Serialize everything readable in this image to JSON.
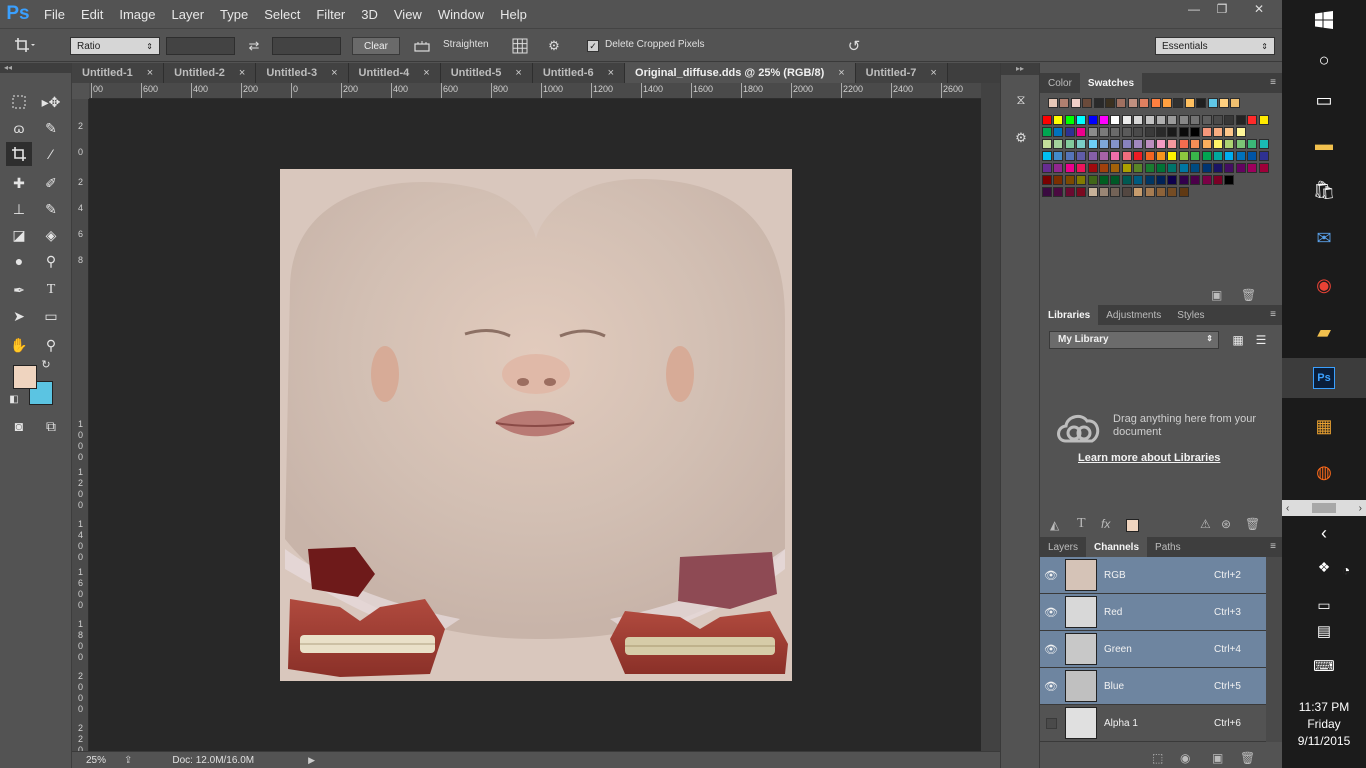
{
  "app": {
    "logo": "Ps"
  },
  "menu": [
    "File",
    "Edit",
    "Image",
    "Layer",
    "Type",
    "Select",
    "Filter",
    "3D",
    "View",
    "Window",
    "Help"
  ],
  "window_controls": {
    "minimize": "—",
    "restore": "❐",
    "close": "✕"
  },
  "options": {
    "ratio_select": "Ratio",
    "clear_label": "Clear",
    "straighten_label": "Straighten",
    "delete_cropped_label": "Delete Cropped Pixels",
    "delete_cropped_checked": true,
    "workspace_select": "Essentials"
  },
  "document_tabs": [
    {
      "label": "Untitled-1",
      "active": false
    },
    {
      "label": "Untitled-2",
      "active": false
    },
    {
      "label": "Untitled-3",
      "active": false
    },
    {
      "label": "Untitled-4",
      "active": false
    },
    {
      "label": "Untitled-5",
      "active": false
    },
    {
      "label": "Untitled-6",
      "active": false
    },
    {
      "label": "Original_diffuse.dds @ 25% (RGB/8)",
      "active": true
    },
    {
      "label": "Untitled-7",
      "active": false
    }
  ],
  "ruler_h": [
    "00",
    "600",
    "400",
    "200",
    "0",
    "200",
    "400",
    "600",
    "800",
    "1000",
    "1200",
    "1400",
    "1600",
    "1800",
    "2000",
    "2200",
    "2400",
    "2600"
  ],
  "ruler_v": [
    "2",
    "0",
    "2",
    "4",
    "6",
    "8",
    "1 0 0 0",
    "1 2 0 0",
    "1 4 0 0",
    "1 6 0 0",
    "1 8 0 0",
    "2 0 0 0",
    "2 2 0 0"
  ],
  "status": {
    "zoom": "25%",
    "doc_info": "Doc: 12.0M/16.0M"
  },
  "swatches_panel": {
    "tabs": [
      "Color",
      "Swatches"
    ],
    "active_tab": "Swatches",
    "recent": [
      "#e8c9b8",
      "#b08070",
      "#f0d0c8",
      "#6a4a3a",
      "#2a2a2a",
      "#3a3020",
      "#a07060",
      "#c09080",
      "#e08060",
      "#ff8040",
      "#ffa040",
      "#303030",
      "#ffc060",
      "#202020",
      "#60c8e8",
      "#ffd080",
      "#f0c070"
    ],
    "rows": [
      [
        "#ff0000",
        "#ffff00",
        "#00ff00",
        "#00ffff",
        "#0000ff",
        "#ff00ff",
        "#ffffff",
        "#ebebeb",
        "#d7d7d7",
        "#c3c3c3",
        "#afafaf",
        "#9b9b9b",
        "#878787",
        "#737373",
        "#5f5f5f",
        "#4b4b4b",
        "#373737",
        "#232323",
        "#ff2a2a",
        "#ffea00"
      ],
      [
        "#00a651",
        "#0072bc",
        "#2e3192",
        "#ec008c",
        "#8c8c8c",
        "#7a7a7a",
        "#6a6a6a",
        "#5a5a5a",
        "#4a4a4a",
        "#3a3a3a",
        "#2a2a2a",
        "#1a1a1a",
        "#0a0a0a",
        "#000000",
        "#f7977a",
        "#f9ad81",
        "#fdc68a",
        "#fff79a"
      ],
      [
        "#c4df9b",
        "#a3d39c",
        "#82ca9d",
        "#7bcdc8",
        "#6ecff6",
        "#7ea7d8",
        "#8493ca",
        "#8882be",
        "#a187be",
        "#bc8dbf",
        "#f49ac2",
        "#f6989d",
        "#f26c4f",
        "#f68e56",
        "#fbaf5d",
        "#fff568",
        "#acd372",
        "#7cc576",
        "#3bb878",
        "#1abbb4"
      ],
      [
        "#00bff3",
        "#438ccb",
        "#5574b9",
        "#605ca8",
        "#855fa8",
        "#a763a8",
        "#f06eaa",
        "#f26d7d",
        "#ed1c24",
        "#f26522",
        "#f7941d",
        "#fff200",
        "#8dc73f",
        "#39b54a",
        "#00a651",
        "#00a99d",
        "#00aeef",
        "#0072bc",
        "#0054a6",
        "#2e3192"
      ],
      [
        "#662d91",
        "#92278f",
        "#ec008c",
        "#ed145b",
        "#9e0b0f",
        "#a0410d",
        "#a3620a",
        "#aba000",
        "#598527",
        "#1a7b30",
        "#007236",
        "#00746b",
        "#0076a3",
        "#004b80",
        "#003471",
        "#1b1464",
        "#440e62",
        "#630460",
        "#9e005d",
        "#9e0039"
      ],
      [
        "#790000",
        "#7b2e00",
        "#7d4900",
        "#827b00",
        "#406618",
        "#005e20",
        "#005826",
        "#005952",
        "#005b7f",
        "#003663",
        "#002157",
        "#0d004c",
        "#32004b",
        "#4b0049",
        "#7b0046",
        "#7a0026",
        "#000000"
      ],
      [
        "#3a0a40",
        "#4a0a40",
        "#6a0a30",
        "#7a0a20",
        "#c7b299",
        "#998675",
        "#736357",
        "#534741",
        "#c69c6d",
        "#a67c52",
        "#8c6239",
        "#754c24",
        "#603913"
      ]
    ]
  },
  "libraries_panel": {
    "tabs": [
      "Libraries",
      "Adjustments",
      "Styles"
    ],
    "active_tab": "Libraries",
    "library_select": "My Library",
    "drag_text": "Drag anything here from your document",
    "learn_more_link": "Learn more about Libraries"
  },
  "channels_panel": {
    "tabs": [
      "Layers",
      "Channels",
      "Paths"
    ],
    "active_tab": "Channels",
    "channels": [
      {
        "name": "RGB",
        "shortcut": "Ctrl+2",
        "visible": true,
        "selected": true
      },
      {
        "name": "Red",
        "shortcut": "Ctrl+3",
        "visible": true,
        "selected": true
      },
      {
        "name": "Green",
        "shortcut": "Ctrl+4",
        "visible": true,
        "selected": true
      },
      {
        "name": "Blue",
        "shortcut": "Ctrl+5",
        "visible": true,
        "selected": true
      },
      {
        "name": "Alpha 1",
        "shortcut": "Ctrl+6",
        "visible": false,
        "selected": false
      }
    ]
  },
  "taskbar": {
    "time": "11:37 PM",
    "day": "Friday",
    "date": "9/11/2015",
    "ps_label": "Ps"
  },
  "colors": {
    "foreground": "#efd4bf",
    "background": "#5bc4e2",
    "selection": "#6e85a0"
  }
}
